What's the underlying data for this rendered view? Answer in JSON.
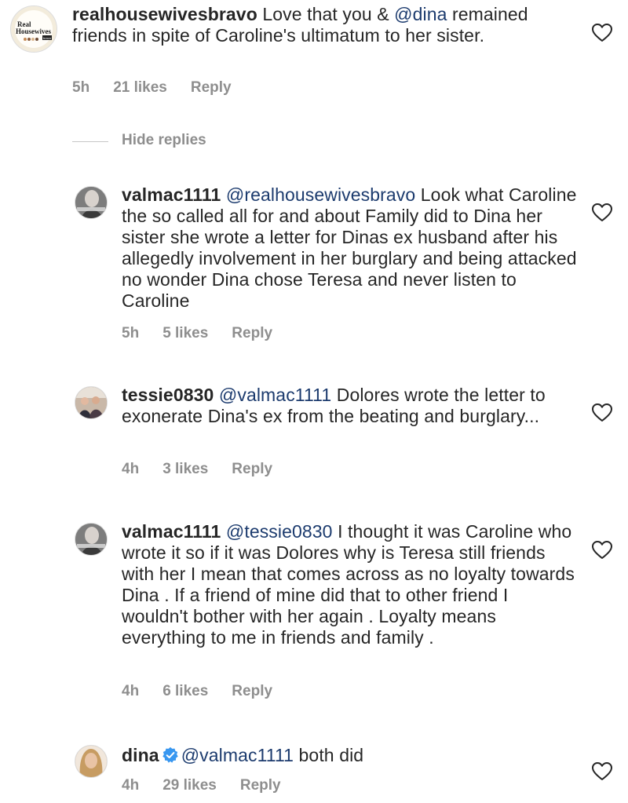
{
  "comments": [
    {
      "username": "realhousewivesbravo",
      "prefix": " Love that you & ",
      "mention": "@dina",
      "text": " remained friends in spite of Caroline's ultimatum to her sister.",
      "time": "5h",
      "likes": "21 likes",
      "reply": "Reply",
      "avatar_line1": "Real",
      "avatar_line2": "Housewives",
      "avatar_badge": "bravo"
    },
    {
      "username": "valmac1111",
      "mention": "@realhousewivesbravo",
      "text": " Look what Caroline the so called  all for and about Family did to Dina her sister she wrote a letter for Dinas ex husband after his allegedly involvement in her burglary and being attacked no wonder Dina chose Teresa and never listen to Caroline",
      "time": "5h",
      "likes": "5 likes",
      "reply": "Reply"
    },
    {
      "username": "tessie0830",
      "mention": "@valmac1111",
      "text": " Dolores wrote the letter to exonerate Dina's ex from the beating and burglary...",
      "time": "4h",
      "likes": "3 likes",
      "reply": "Reply"
    },
    {
      "username": "valmac1111",
      "mention": "@tessie0830",
      "text": " I thought it was Caroline who wrote it so if it was Dolores why is Teresa still friends with her I mean that comes across as no loyalty towards Dina . If a friend of mine did that to other friend I wouldn't bother with her again . Loyalty means everything to me in friends and family .",
      "time": "4h",
      "likes": "6 likes",
      "reply": "Reply"
    },
    {
      "username": "dina",
      "mention": "@valmac1111",
      "text": " both did",
      "time": "4h",
      "likes": "29 likes",
      "reply": "Reply"
    }
  ],
  "hide_replies": "Hide replies",
  "colors": {
    "mention": "#1c3b6e",
    "meta": "#8e8e8e",
    "verified": "#3897f0"
  },
  "icons": {
    "like": "heart-outline-icon",
    "verified": "verified-badge-icon"
  }
}
